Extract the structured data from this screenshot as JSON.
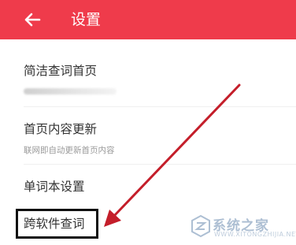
{
  "header": {
    "title": "设置",
    "back_icon": "back-arrow-icon",
    "background": "#ef3b4b"
  },
  "settings": {
    "items": [
      {
        "label": "简洁查词首页"
      },
      {
        "label": "首页内容更新",
        "subtitle": "联网即自动更新首页内容"
      },
      {
        "label": "单词本设置"
      },
      {
        "label": "跨软件查词"
      }
    ]
  },
  "annotation": {
    "arrow_color": "#c41e2a",
    "box_color": "#111111"
  },
  "watermark": {
    "text": "系统之家",
    "url": "WWW.XITONGZHIJIA.NET"
  }
}
